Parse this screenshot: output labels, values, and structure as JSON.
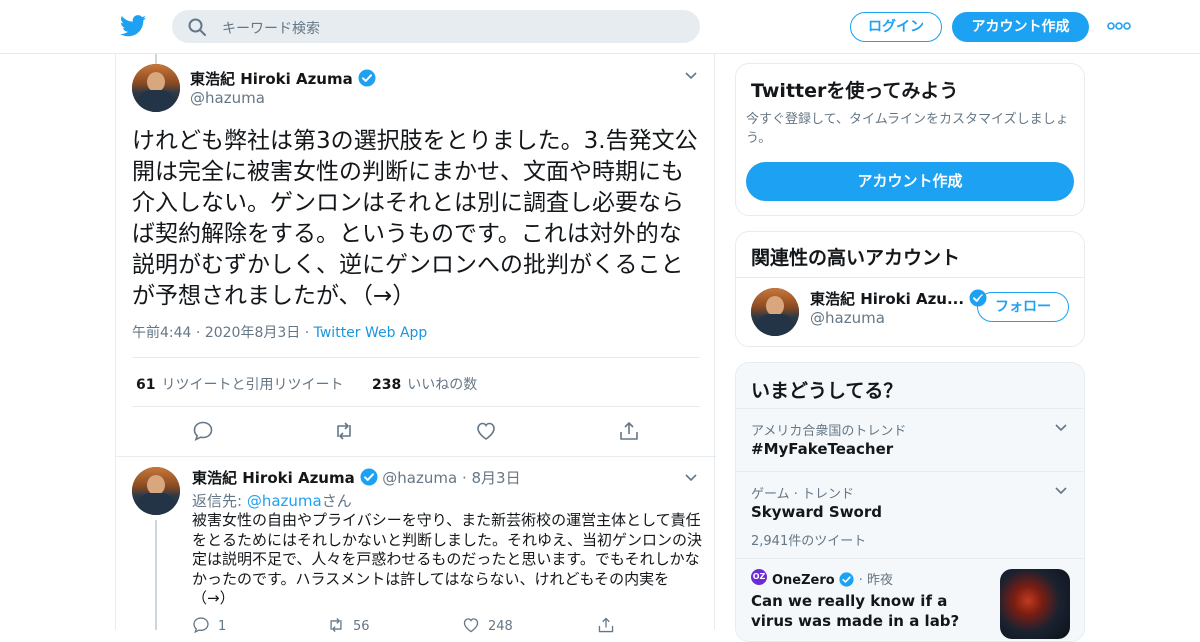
{
  "header": {
    "search_placeholder": "キーワード検索",
    "login_label": "ログイン",
    "signup_label": "アカウント作成"
  },
  "tweet": {
    "author_name": "東浩紀 Hiroki Azuma",
    "author_handle": "@hazuma",
    "text": "けれども弊社は第3の選択肢をとりました。3.告発文公開は完全に被害女性の判断にまかせ、文面や時期にも介入しない。ゲンロンはそれとは別に調査し必要ならば契約解除をする。というものです。これは対外的な説明がむずかしく、逆にゲンロンへの批判がくることが予想されましたが、（→）",
    "time": "午前4:44",
    "date": "2020年8月3日",
    "source": "Twitter Web App",
    "retweet_count": "61",
    "retweet_label": "リツイートと引用リツイート",
    "like_count": "238",
    "like_label": "いいねの数"
  },
  "reply": {
    "author_name": "東浩紀 Hiroki Azuma",
    "author_handle": "@hazuma",
    "date": "8月3日",
    "reply_to_prefix": "返信先: ",
    "reply_to_handle": "@hazuma",
    "reply_to_suffix": "さん",
    "text": "被害女性の自由やプライバシーを守り、また新芸術校の運営主体として責任をとるためにはそれしかないと判断しました。それゆえ、当初ゲンロンの決定は説明不足で、人々を戸惑わせるものだったと思います。でもそれしかなかったのです。ハラスメントは許してはならない、けれどもその内実を（→）",
    "reply_count": "1",
    "retweet_count": "56",
    "like_count": "248"
  },
  "sidebar": {
    "signup_card": {
      "title": "Twitterを使ってみよう",
      "description": "今すぐ登録して、タイムラインをカスタマイズしましょう。",
      "button": "アカウント作成"
    },
    "related": {
      "title": "関連性の高いアカウント",
      "name": "東浩紀 Hiroki Azu...",
      "handle": "@hazuma",
      "follow": "フォロー"
    },
    "trends": {
      "title": "いまどうしてる？",
      "items": [
        {
          "category": "アメリカ合衆国のトレンド",
          "name": "#MyFakeTeacher",
          "count": ""
        },
        {
          "category": "ゲーム · トレンド",
          "name": "Skyward Sword",
          "count": "2,941件のツイート"
        }
      ],
      "news": {
        "badge": "OZ",
        "source": "OneZero",
        "time": "昨夜",
        "headline": "Can we really know if a virus was made in a lab?"
      }
    }
  },
  "colors": {
    "accent": "#1da1f2",
    "text": "#14171a",
    "muted": "#657786",
    "border": "#e6ecf0"
  }
}
